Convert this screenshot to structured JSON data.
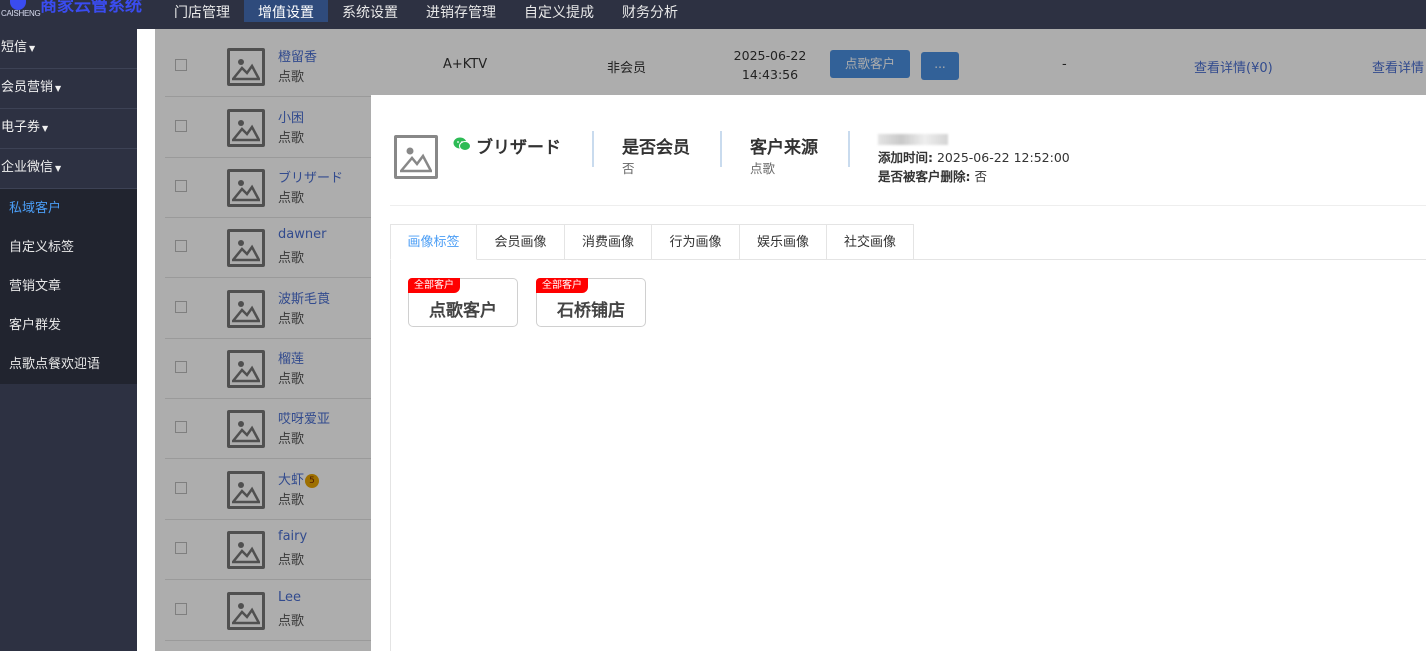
{
  "brand": {
    "logo_text": "CAISHENG",
    "name": "商家云管系统"
  },
  "topnav": [
    "门店管理",
    "增值设置",
    "系统设置",
    "进销存管理",
    "自定义提成",
    "财务分析"
  ],
  "topnav_active": 1,
  "sidebar": {
    "groups": [
      "短信",
      "会员营销",
      "电子券",
      "企业微信"
    ],
    "subitems": [
      "私域客户",
      "自定义标签",
      "营销文章",
      "客户群发",
      "点歌点餐欢迎语"
    ]
  },
  "table": {
    "rows": [
      {
        "name": "橙留香",
        "source": "点歌",
        "package": "A+KTV",
        "member": "非会员",
        "date": "2025-06-22",
        "time": "14:43:56",
        "btn": "点歌客户",
        "more": "...",
        "dash": "-",
        "link1": "查看详情(¥0)",
        "link2": "查看详情"
      },
      {
        "name": "小困",
        "source": "点歌"
      },
      {
        "name": "ブリザード",
        "source": "点歌"
      },
      {
        "name": "dawner",
        "source": "点歌"
      },
      {
        "name": "波斯毛莨",
        "source": "点歌"
      },
      {
        "name": "榴莲",
        "source": "点歌"
      },
      {
        "name": "哎呀爱亚",
        "source": "点歌"
      },
      {
        "name": "大虾",
        "source": "点歌",
        "badge": "5"
      },
      {
        "name": "fairy",
        "source": "点歌"
      },
      {
        "name": "Lee",
        "source": "点歌"
      }
    ]
  },
  "modal": {
    "name": "ブリザード",
    "member_label": "是否会员",
    "member_value": "否",
    "source_label": "客户来源",
    "source_value": "点歌",
    "add_time_label": "添加时间:",
    "add_time_value": "2025-06-22 12:52:00",
    "deleted_label": "是否被客户删除:",
    "deleted_value": "否",
    "tabs": [
      "画像标签",
      "会员画像",
      "消费画像",
      "行为画像",
      "娱乐画像",
      "社交画像"
    ],
    "active_tab": 0,
    "tags": [
      {
        "flag": "全部客户",
        "text": "点歌客户"
      },
      {
        "flag": "全部客户",
        "text": "石桥铺店"
      }
    ]
  },
  "colors": {
    "nav_bg": "#2d3142",
    "accent": "#4a9df5",
    "button": "#4a8fe0",
    "flag": "#ff0000"
  }
}
